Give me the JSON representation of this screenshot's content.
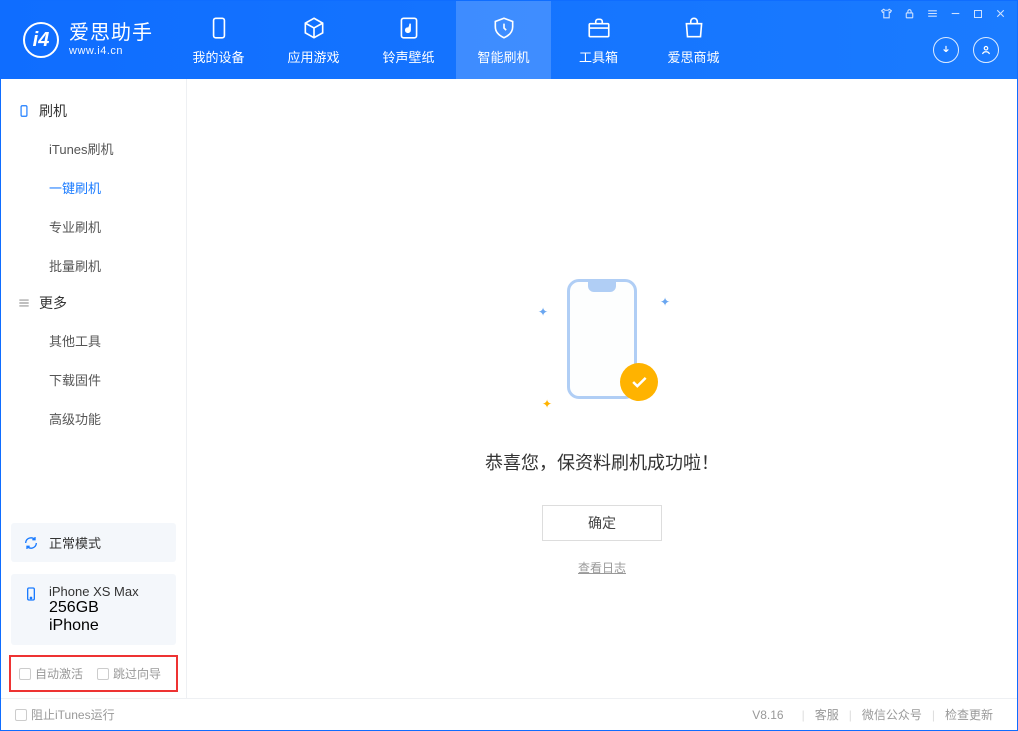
{
  "logo": {
    "name": "爱思助手",
    "url": "www.i4.cn"
  },
  "nav": [
    {
      "label": "我的设备"
    },
    {
      "label": "应用游戏"
    },
    {
      "label": "铃声壁纸"
    },
    {
      "label": "智能刷机"
    },
    {
      "label": "工具箱"
    },
    {
      "label": "爱思商城"
    }
  ],
  "sidebar": {
    "flash_header": "刷机",
    "flash_items": [
      "iTunes刷机",
      "一键刷机",
      "专业刷机",
      "批量刷机"
    ],
    "more_header": "更多",
    "more_items": [
      "其他工具",
      "下载固件",
      "高级功能"
    ],
    "mode_box": "正常模式",
    "device": {
      "name": "iPhone XS Max",
      "storage": "256GB",
      "type": "iPhone"
    },
    "checks": [
      "自动激活",
      "跳过向导"
    ]
  },
  "main": {
    "success_msg": "恭喜您，保资料刷机成功啦！",
    "ok_button": "确定",
    "view_log": "查看日志"
  },
  "footer": {
    "block_itunes": "阻止iTunes运行",
    "version": "V8.16",
    "links": [
      "客服",
      "微信公众号",
      "检查更新"
    ]
  }
}
